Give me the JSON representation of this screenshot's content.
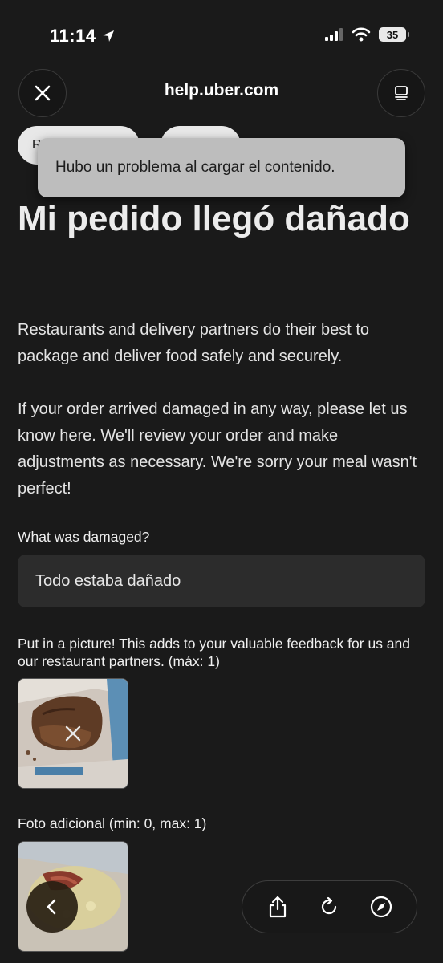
{
  "status_bar": {
    "time": "11:14",
    "battery": "35",
    "icons": [
      "location-arrow-icon",
      "signal-icon",
      "wifi-icon",
      "battery-icon"
    ]
  },
  "browser": {
    "url": "help.uber.com",
    "icons": [
      "close-icon",
      "reader-icon",
      "back-icon",
      "share-icon",
      "reload-icon",
      "compass-icon"
    ]
  },
  "chips": [
    "R",
    ""
  ],
  "toast": {
    "message": "Hubo un problema al cargar el contenido."
  },
  "page": {
    "title": "Mi pedido llegó dañado",
    "paragraph1": "Restaurants and delivery partners do their best to package and deliver food safely and securely.",
    "paragraph2": "If your order arrived damaged in any way, please let us know here. We'll review your order and make adjustments as necessary. We're sorry your meal wasn't perfect!",
    "damage_label": "What was damaged?",
    "damage_value": "Todo estaba dañado",
    "picture_label": "Put in a picture! This adds to your valuable feedback for us and our restaurant partners. (máx: 1)",
    "additional_label": "Foto adicional (min: 0, max: 1)"
  },
  "colors": {
    "background": "#1a1a1a",
    "toast": "#bdbdbd",
    "field": "#2c2c2c",
    "back_button": "#281f12"
  }
}
